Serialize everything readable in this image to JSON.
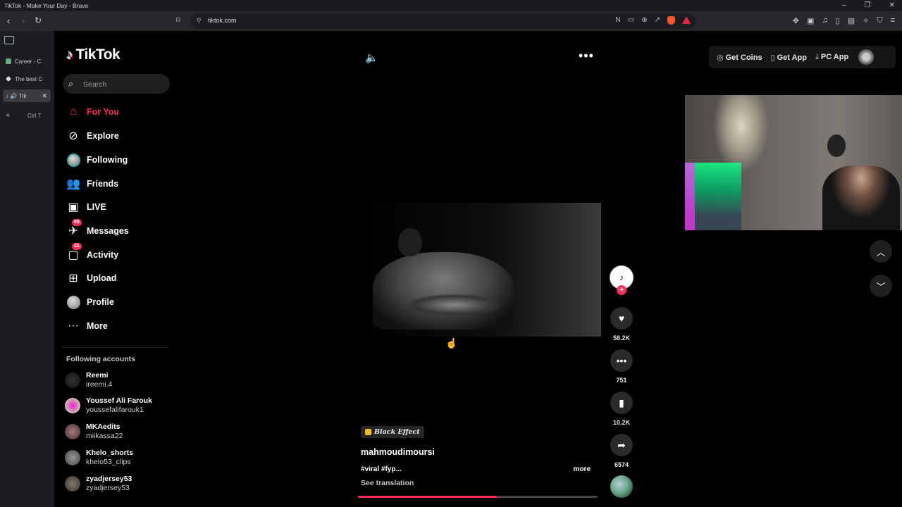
{
  "window": {
    "title": "TikTok - Make Your Day - Brave"
  },
  "browser": {
    "url": "tiktok.com",
    "tabs": [
      {
        "label": "Career - C"
      },
      {
        "label": "The best C"
      },
      {
        "label": "Tik"
      }
    ],
    "new_tab_hint": "Ctrl T"
  },
  "app": {
    "logo": "TikTok",
    "search": {
      "placeholder": "Search"
    },
    "nav": [
      {
        "label": "For You",
        "icon": "home-icon",
        "active": true
      },
      {
        "label": "Explore",
        "icon": "compass-icon"
      },
      {
        "label": "Following",
        "icon": "following-avatar-icon"
      },
      {
        "label": "Friends",
        "icon": "friends-icon"
      },
      {
        "label": "LIVE",
        "icon": "live-icon"
      },
      {
        "label": "Messages",
        "icon": "messages-icon",
        "badge": "69"
      },
      {
        "label": "Activity",
        "icon": "activity-icon",
        "badge": "21"
      },
      {
        "label": "Upload",
        "icon": "upload-icon"
      },
      {
        "label": "Profile",
        "icon": "profile-avatar-icon"
      },
      {
        "label": "More",
        "icon": "more-icon"
      }
    ],
    "following_title": "Following accounts",
    "following": [
      {
        "name": "Reemi",
        "user": "ireemi.4"
      },
      {
        "name": "Youssef Ali Farouk",
        "user": "youssefalifarouk1"
      },
      {
        "name": "MKAedits",
        "user": "miikassa22"
      },
      {
        "name": "Khelo_shorts",
        "user": "khelo53_clips"
      },
      {
        "name": "zyadjersey53",
        "user": "zyadjersey53"
      }
    ],
    "top": {
      "get_coins": "Get Coins",
      "get_app": "Get App",
      "pc_app": "PC App"
    },
    "video": {
      "effect": "Black Effect",
      "author": "mahmoudimoursi",
      "caption": "#viral #fyp...",
      "more": "more",
      "translation": "See translation",
      "progress": 0.58
    },
    "actions": {
      "likes": "58.2K",
      "comments": "751",
      "saves": "10.2K",
      "shares": "6574"
    },
    "colors": {
      "accent": "#fe2c55"
    }
  }
}
